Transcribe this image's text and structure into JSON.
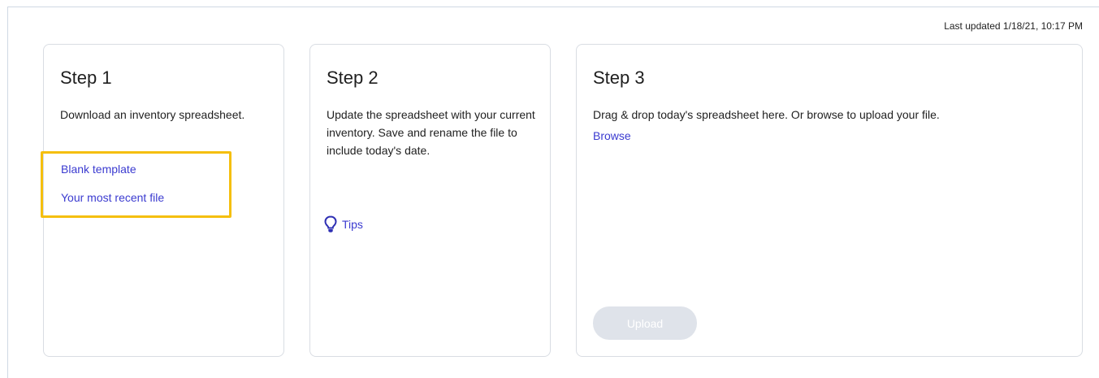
{
  "header": {
    "last_updated": "Last updated 1/18/21, 10:17 PM"
  },
  "step1": {
    "title": "Step 1",
    "text": "Download an inventory spreadsheet.",
    "links": {
      "blank_template": "Blank template",
      "recent_file": "Your most recent file"
    },
    "highlight_color": "#f5bf0e"
  },
  "step2": {
    "title": "Step 2",
    "text": "Update the spreadsheet with your current inventory. Save and rename the file to include today's date.",
    "tips_label": "Tips",
    "tips_icon": "lightbulb-icon"
  },
  "step3": {
    "title": "Step 3",
    "text": "Drag & drop today's spreadsheet here. Or browse to upload your file.",
    "browse_label": "Browse",
    "upload_label": "Upload",
    "upload_disabled": true
  },
  "colors": {
    "link": "#3b3bd0",
    "disabled_button": "#dfe3ea"
  }
}
